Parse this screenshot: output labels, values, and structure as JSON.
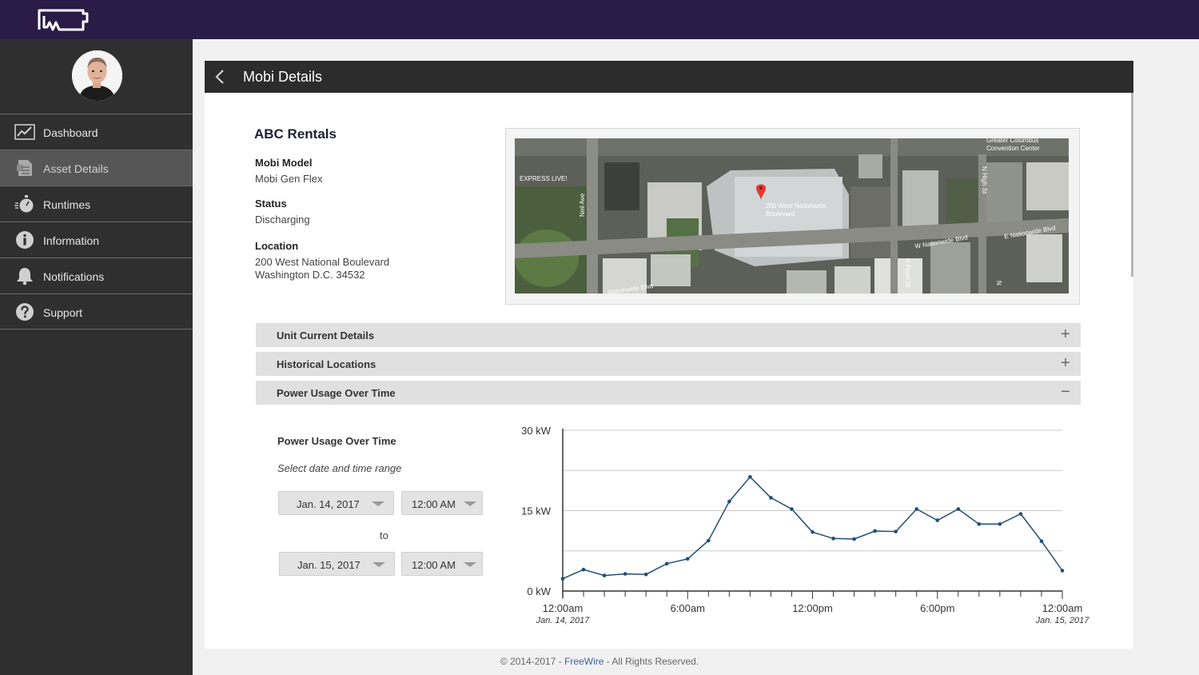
{
  "app": {
    "logo_icon": "freewire-logo-icon"
  },
  "sidebar": {
    "avatar_icon": "user-avatar",
    "items": [
      {
        "label": "Dashboard",
        "icon": "chart-line-icon",
        "active": false
      },
      {
        "label": "Asset Details",
        "icon": "document-list-icon",
        "active": true
      },
      {
        "label": "Runtimes",
        "icon": "stopwatch-icon",
        "active": false
      },
      {
        "label": "Information",
        "icon": "info-icon",
        "active": false
      },
      {
        "label": "Notifications",
        "icon": "bell-icon",
        "active": false
      },
      {
        "label": "Support",
        "icon": "question-icon",
        "active": false
      }
    ]
  },
  "panel": {
    "title": "Mobi Details",
    "company": "ABC Rentals",
    "model_label": "Mobi Model",
    "model_value": "Mobi Gen Flex",
    "status_label": "Status",
    "status_value": "Discharging",
    "location_label": "Location",
    "location_line1": "200 West National Boulevard",
    "location_line2": "Washington D.C. 34532"
  },
  "map": {
    "pin_label_1": "200 West Nationwide",
    "pin_label_2": "Boulevard",
    "labels": {
      "express": "EXPRESS LIVE!",
      "convention_1": "Greater Columbus",
      "convention_2": "Convention Center",
      "neil": "Neil Ave",
      "w_nationwide": "W Nationwide Blvd",
      "e_nationwide": "E Nationwide Blvd",
      "n_front": "N Front St",
      "n_high": "N High St",
      "n_short": "N",
      "nationwide_left": "Nationwide Blvd"
    }
  },
  "accordion": [
    {
      "label": "Unit Current Details",
      "sign": "+"
    },
    {
      "label": "Historical Locations",
      "sign": "+"
    },
    {
      "label": "Power Usage Over Time",
      "sign": "−"
    }
  ],
  "power_usage": {
    "title": "Power Usage Over Time",
    "subtitle": "Select date and time range",
    "from_date": "Jan. 14, 2017",
    "from_time": "12:00 AM",
    "to_label": "to",
    "to_date": "Jan. 15, 2017",
    "to_time": "12:00 AM"
  },
  "chart_data": {
    "type": "line",
    "ylim": [
      0,
      30
    ],
    "y_ticks": [
      {
        "value": 0,
        "label": "0 kW"
      },
      {
        "value": 15,
        "label": "15 kW"
      },
      {
        "value": 30,
        "label": "30 kW"
      }
    ],
    "grid_values": [
      7.5,
      22.5
    ],
    "xlim": [
      0,
      24
    ],
    "x_ticks": [
      {
        "value": 0,
        "label": "12:00am",
        "sublabel": "Jan. 14, 2017"
      },
      {
        "value": 6,
        "label": "6:00am",
        "sublabel": ""
      },
      {
        "value": 12,
        "label": "12:00pm",
        "sublabel": ""
      },
      {
        "value": 18,
        "label": "6:00pm",
        "sublabel": ""
      },
      {
        "value": 24,
        "label": "12:00am",
        "sublabel": "Jan. 15, 2017"
      }
    ],
    "series": [
      {
        "color": "#1f4e7a",
        "x": [
          0,
          1,
          2,
          3,
          4,
          5,
          6,
          7,
          8,
          9,
          10,
          11,
          12,
          13,
          14,
          15,
          16,
          17,
          18,
          19,
          20,
          21,
          22,
          23,
          24
        ],
        "values": [
          2.3,
          4.0,
          2.9,
          3.2,
          3.1,
          5.1,
          6.0,
          9.4,
          16.7,
          21.3,
          17.4,
          15.3,
          11.0,
          9.8,
          9.7,
          11.2,
          11.1,
          15.3,
          13.2,
          15.3,
          12.5,
          12.5,
          14.4,
          9.3,
          3.8
        ]
      }
    ]
  },
  "footer": {
    "prefix": "© 2014-2017 - ",
    "link": "FreeWire",
    "suffix": " - All Rights Reserved."
  }
}
